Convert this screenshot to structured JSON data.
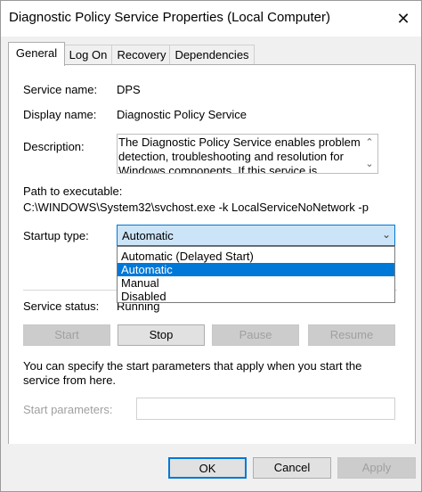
{
  "window": {
    "title": "Diagnostic Policy Service Properties (Local Computer)",
    "close_glyph": "✕"
  },
  "tabs": [
    {
      "label": "General",
      "active": true
    },
    {
      "label": "Log On",
      "active": false
    },
    {
      "label": "Recovery",
      "active": false
    },
    {
      "label": "Dependencies",
      "active": false
    }
  ],
  "general": {
    "service_name_label": "Service name:",
    "service_name": "DPS",
    "display_name_label": "Display name:",
    "display_name": "Diagnostic Policy Service",
    "description_label": "Description:",
    "description": "The Diagnostic Policy Service enables problem detection, troubleshooting and resolution for Windows components. If this service is stopped",
    "path_label": "Path to executable:",
    "path": "C:\\WINDOWS\\System32\\svchost.exe -k LocalServiceNoNetwork -p",
    "startup_type_label": "Startup type:",
    "startup_type_value": "Automatic",
    "startup_options": [
      "Automatic (Delayed Start)",
      "Automatic",
      "Manual",
      "Disabled"
    ],
    "startup_selected_index": 1,
    "service_status_label": "Service status:",
    "service_status": "Running",
    "start_label": "Start",
    "stop_label": "Stop",
    "pause_label": "Pause",
    "resume_label": "Resume",
    "params_hint": "You can specify the start parameters that apply when you start the service from here.",
    "start_params_label": "Start parameters:",
    "start_params_value": ""
  },
  "footer": {
    "ok_label": "OK",
    "cancel_label": "Cancel",
    "apply_label": "Apply"
  },
  "colors": {
    "accent": "#0078d7",
    "selection_bg": "#0078d7",
    "combo_bg": "#cce4f7"
  }
}
